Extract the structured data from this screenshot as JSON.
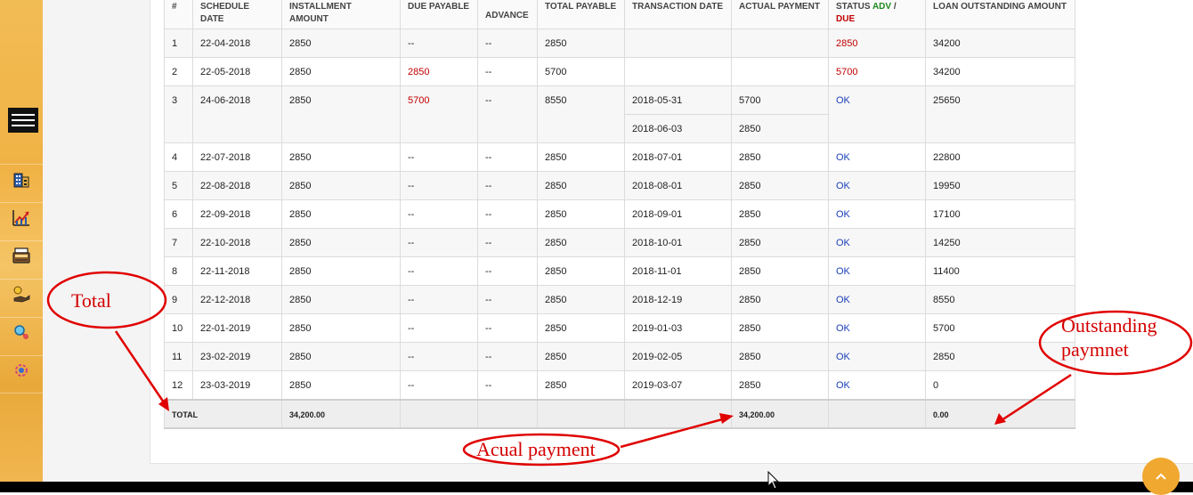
{
  "table": {
    "headers": {
      "num": "#",
      "schedule_date": "SCHEDULE DATE",
      "installment_amount": "INSTALLMENT AMOUNT",
      "due_payable": "DUE PAYABLE",
      "advance": "ADVANCE",
      "total_payable": "TOTAL PAYABLE",
      "transaction_date": "TRANSACTION DATE",
      "actual_payment": "ACTUAL PAYMENT",
      "status_prefix": "STATUS",
      "status_adv": "ADV",
      "status_sep": "/",
      "status_due": "DUE",
      "loan_outstanding": "LOAN OUTSTANDING AMOUNT"
    },
    "rows": [
      {
        "n": "1",
        "date": "22-04-2018",
        "inst": "2850",
        "due": "--",
        "adv": "--",
        "total": "2850",
        "txn": [],
        "pay": [],
        "status": "2850",
        "status_type": "due",
        "out": "34200"
      },
      {
        "n": "2",
        "date": "22-05-2018",
        "inst": "2850",
        "due": "2850",
        "adv": "--",
        "total": "5700",
        "txn": [],
        "pay": [],
        "status": "5700",
        "status_type": "due",
        "out": "34200"
      },
      {
        "n": "3",
        "date": "24-06-2018",
        "inst": "2850",
        "due": "5700",
        "adv": "--",
        "total": "8550",
        "txn": [
          "2018-05-31",
          "2018-06-03"
        ],
        "pay": [
          "5700",
          "2850"
        ],
        "status": "OK",
        "status_type": "ok",
        "out": "25650"
      },
      {
        "n": "4",
        "date": "22-07-2018",
        "inst": "2850",
        "due": "--",
        "adv": "--",
        "total": "2850",
        "txn": [
          "2018-07-01"
        ],
        "pay": [
          "2850"
        ],
        "status": "OK",
        "status_type": "ok",
        "out": "22800"
      },
      {
        "n": "5",
        "date": "22-08-2018",
        "inst": "2850",
        "due": "--",
        "adv": "--",
        "total": "2850",
        "txn": [
          "2018-08-01"
        ],
        "pay": [
          "2850"
        ],
        "status": "OK",
        "status_type": "ok",
        "out": "19950"
      },
      {
        "n": "6",
        "date": "22-09-2018",
        "inst": "2850",
        "due": "--",
        "adv": "--",
        "total": "2850",
        "txn": [
          "2018-09-01"
        ],
        "pay": [
          "2850"
        ],
        "status": "OK",
        "status_type": "ok",
        "out": "17100"
      },
      {
        "n": "7",
        "date": "22-10-2018",
        "inst": "2850",
        "due": "--",
        "adv": "--",
        "total": "2850",
        "txn": [
          "2018-10-01"
        ],
        "pay": [
          "2850"
        ],
        "status": "OK",
        "status_type": "ok",
        "out": "14250"
      },
      {
        "n": "8",
        "date": "22-11-2018",
        "inst": "2850",
        "due": "--",
        "adv": "--",
        "total": "2850",
        "txn": [
          "2018-11-01"
        ],
        "pay": [
          "2850"
        ],
        "status": "OK",
        "status_type": "ok",
        "out": "11400"
      },
      {
        "n": "9",
        "date": "22-12-2018",
        "inst": "2850",
        "due": "--",
        "adv": "--",
        "total": "2850",
        "txn": [
          "2018-12-19"
        ],
        "pay": [
          "2850"
        ],
        "status": "OK",
        "status_type": "ok",
        "out": "8550"
      },
      {
        "n": "10",
        "date": "22-01-2019",
        "inst": "2850",
        "due": "--",
        "adv": "--",
        "total": "2850",
        "txn": [
          "2019-01-03"
        ],
        "pay": [
          "2850"
        ],
        "status": "OK",
        "status_type": "ok",
        "out": "5700"
      },
      {
        "n": "11",
        "date": "23-02-2019",
        "inst": "2850",
        "due": "--",
        "adv": "--",
        "total": "2850",
        "txn": [
          "2019-02-05"
        ],
        "pay": [
          "2850"
        ],
        "status": "OK",
        "status_type": "ok",
        "out": "2850"
      },
      {
        "n": "12",
        "date": "23-03-2019",
        "inst": "2850",
        "due": "--",
        "adv": "--",
        "total": "2850",
        "txn": [
          "2019-03-07"
        ],
        "pay": [
          "2850"
        ],
        "status": "OK",
        "status_type": "ok",
        "out": "0"
      }
    ],
    "totals": {
      "label": "TOTAL",
      "installment": "34,200.00",
      "actual_payment": "34,200.00",
      "outstanding": "0.00"
    }
  },
  "annotations": {
    "total": "Total",
    "actual_payment": "Acual payment",
    "outstanding_line1": "Outstanding",
    "outstanding_line2": "paymnet"
  },
  "colors": {
    "sidebar": "#f0b245",
    "due_text": "#c00000",
    "ok_text": "#1a3fb8",
    "adv_text": "#1c8a1c",
    "annotation": "#e00000",
    "scroll_button": "#f0a830"
  },
  "icons": {
    "menu": "hamburger-menu-icon",
    "sidebar": [
      "building-icon",
      "chart-growth-icon",
      "cash-register-icon",
      "hand-coin-icon",
      "search-gear-icon",
      "settings-flower-icon"
    ],
    "scroll_top": "chevron-up-icon"
  }
}
